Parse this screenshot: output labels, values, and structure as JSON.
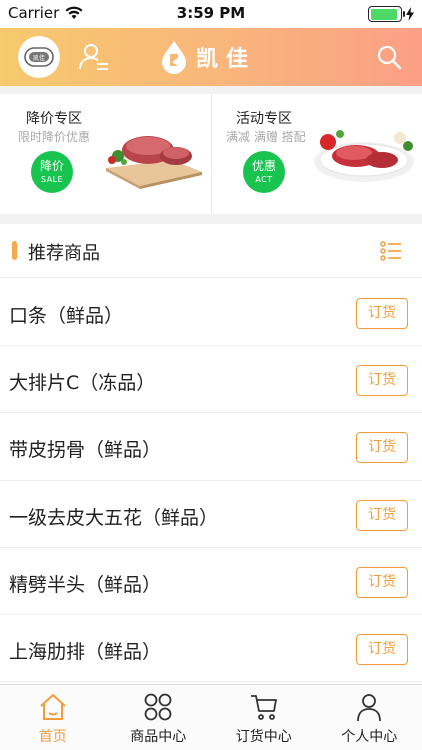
{
  "status_bar": {
    "carrier": "Carrier",
    "time": "3:59 PM",
    "battery_level": 0.9
  },
  "header": {
    "brand": "凯佳",
    "badge_text": "凯佳"
  },
  "promos": [
    {
      "title": "降价专区",
      "subtitle": "限时降价优惠",
      "badge_main": "降价",
      "badge_sub": "SALE"
    },
    {
      "title": "活动专区",
      "subtitle": "满减 满赠 搭配",
      "badge_main": "优惠",
      "badge_sub": "ACT"
    }
  ],
  "recommend": {
    "title": "推荐商品"
  },
  "products": [
    {
      "name": "口条（鲜品）",
      "button": "订货"
    },
    {
      "name": "大排片C（冻品）",
      "button": "订货"
    },
    {
      "name": "带皮拐骨（鲜品）",
      "button": "订货"
    },
    {
      "name": "一级去皮大五花（鲜品）",
      "button": "订货"
    },
    {
      "name": "精劈半头（鲜品）",
      "button": "订货"
    },
    {
      "name": "上海肋排（鲜品）",
      "button": "订货"
    }
  ],
  "tabs": [
    {
      "label": "首页",
      "icon": "home-icon",
      "active": true
    },
    {
      "label": "商品中心",
      "icon": "grid-icon",
      "active": false
    },
    {
      "label": "订货中心",
      "icon": "cart-icon",
      "active": false
    },
    {
      "label": "个人中心",
      "icon": "person-icon",
      "active": false
    }
  ],
  "colors": {
    "accent": "#f39c3b",
    "green": "#18c34f",
    "header_start": "#f6c96e",
    "header_end": "#fb9f86"
  }
}
